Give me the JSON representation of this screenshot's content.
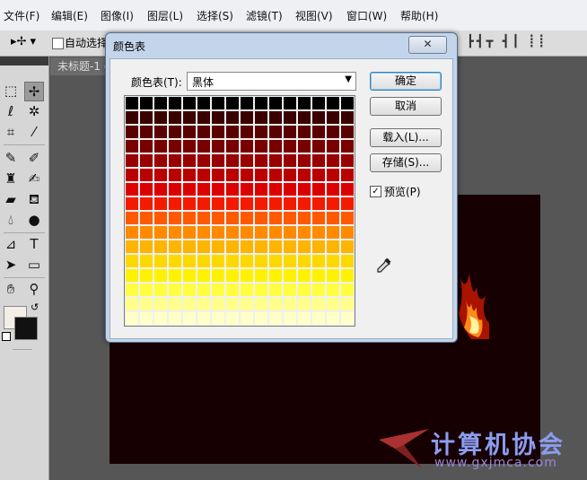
{
  "menu": [
    "文件(F)",
    "编辑(E)",
    "图像(I)",
    "图层(L)",
    "选择(S)",
    "滤镜(T)",
    "视图(V)",
    "窗口(W)",
    "帮助(H)"
  ],
  "options_bar": {
    "auto_select_label": "自动选择"
  },
  "document": {
    "tab_title": "未标题-1 @"
  },
  "dialog": {
    "title": "颜色表",
    "close_glyph": "✕",
    "table_label": "颜色表(T):",
    "table_value": "黑体",
    "ok": "确定",
    "cancel": "取消",
    "load": "载入(L)...",
    "save": "存储(S)...",
    "preview_label": "预览(P)",
    "preview_checked": true
  },
  "color_table": {
    "name": "黑体",
    "rows": 16,
    "cols": 16,
    "colors": [
      "#000000",
      "#3a0000",
      "#5a0000",
      "#780000",
      "#980000",
      "#bb0000",
      "#dd0000",
      "#f41a00",
      "#ff5a00",
      "#ff8a00",
      "#ffb400",
      "#ffd800",
      "#fff200",
      "#ffff40",
      "#ffff8a",
      "#ffffc8"
    ]
  },
  "watermark": {
    "title": "计算机协会",
    "url": "www.gxjmca.com"
  },
  "colors": {
    "canvas": "#160002",
    "fg": "#f4efe6",
    "bg": "#111111"
  },
  "icons": {
    "move": "move-tool-icon",
    "eyedropper": "eyedropper-icon"
  }
}
